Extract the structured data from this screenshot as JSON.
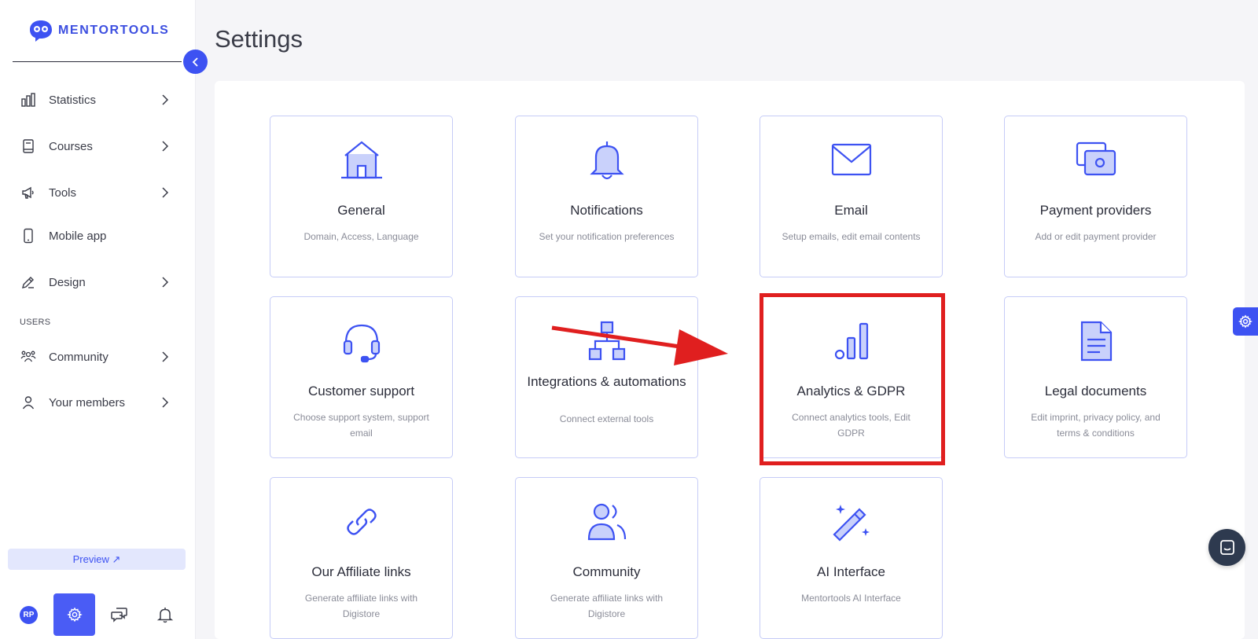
{
  "brand": {
    "name": "MENTORTOOLS"
  },
  "page": {
    "title": "Settings"
  },
  "sidebar": {
    "items": [
      {
        "label": "Statistics",
        "icon": "bar-chart-icon",
        "has_chevron": true
      },
      {
        "label": "Courses",
        "icon": "book-icon",
        "has_chevron": true
      },
      {
        "label": "Tools",
        "icon": "megaphone-icon",
        "has_chevron": true
      },
      {
        "label": "Mobile app",
        "icon": "phone-icon",
        "has_chevron": false
      },
      {
        "label": "Design",
        "icon": "pencil-icon",
        "has_chevron": true
      }
    ],
    "section_users": "USERS",
    "user_items": [
      {
        "label": "Community",
        "icon": "people-icon",
        "has_chevron": true
      },
      {
        "label": "Your members",
        "icon": "user-icon",
        "has_chevron": true
      }
    ],
    "preview_label": "Preview ↗",
    "avatar_initials": "RP"
  },
  "cards": [
    {
      "title": "General",
      "desc": "Domain, Access, Language",
      "icon": "house-icon"
    },
    {
      "title": "Notifications",
      "desc": "Set your notification preferences",
      "icon": "bell-icon"
    },
    {
      "title": "Email",
      "desc": "Setup emails, edit email contents",
      "icon": "envelope-icon"
    },
    {
      "title": "Payment providers",
      "desc": "Add or edit payment provider",
      "icon": "cash-icon"
    },
    {
      "title": "Customer support",
      "desc": "Choose support system, support email",
      "icon": "headset-icon"
    },
    {
      "title": "Integrations & automations",
      "desc": "Connect external tools",
      "icon": "network-icon"
    },
    {
      "title": "Analytics & GDPR",
      "desc": "Connect analytics tools, Edit GDPR",
      "icon": "analytics-icon"
    },
    {
      "title": "Legal documents",
      "desc": "Edit imprint, privacy policy, and terms & conditions",
      "icon": "document-icon"
    },
    {
      "title": "Our Affiliate links",
      "desc": "Generate affiliate links with Digistore",
      "icon": "link-icon"
    },
    {
      "title": "Community",
      "desc": "Generate affiliate links with Digistore",
      "icon": "users-icon"
    },
    {
      "title": "AI Interface",
      "desc": "Mentortools AI Interface",
      "icon": "magic-wand-icon"
    }
  ],
  "colors": {
    "accent": "#3d52f2",
    "highlight": "#e01f1f",
    "card_border": "#c6ccf7"
  }
}
